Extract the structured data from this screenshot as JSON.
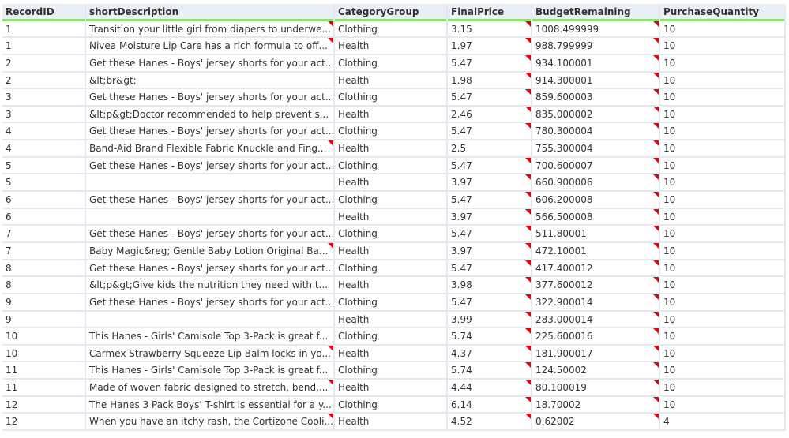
{
  "columns": [
    "RecordID",
    "shortDescription",
    "CategoryGroup",
    "FinalPrice",
    "BudgetRemaining",
    "PurchaseQuantity"
  ],
  "rows": [
    {
      "id": "1",
      "desc": "Transition your little girl from diapers to underwe...",
      "cat": "Clothing",
      "price": "3.15",
      "budget": "1008.499999",
      "qty": "10",
      "df": true,
      "pf": true
    },
    {
      "id": "1",
      "desc": "Nivea Moisture Lip Care has a rich formula to off...",
      "cat": "Health",
      "price": "1.97",
      "budget": "988.799999",
      "qty": "10",
      "df": true,
      "pf": true
    },
    {
      "id": "2",
      "desc": "Get these Hanes - Boys' jersey shorts for your act...",
      "cat": "Clothing",
      "price": "5.47",
      "budget": "934.100001",
      "qty": "10",
      "df": false,
      "pf": true
    },
    {
      "id": "2",
      "desc": "&lt;br&gt;",
      "cat": "Health",
      "price": "1.98",
      "budget": "914.300001",
      "qty": "10",
      "df": false,
      "pf": true
    },
    {
      "id": "3",
      "desc": "Get these Hanes - Boys' jersey shorts for your act...",
      "cat": "Clothing",
      "price": "5.47",
      "budget": "859.600003",
      "qty": "10",
      "df": false,
      "pf": true
    },
    {
      "id": "3",
      "desc": "&lt;p&gt;Doctor recommended to help prevent s...",
      "cat": "Health",
      "price": "2.46",
      "budget": "835.000002",
      "qty": "10",
      "df": false,
      "pf": true
    },
    {
      "id": "4",
      "desc": "Get these Hanes - Boys' jersey shorts for your act...",
      "cat": "Clothing",
      "price": "5.47",
      "budget": "780.300004",
      "qty": "10",
      "df": false,
      "pf": true
    },
    {
      "id": "4",
      "desc": "Band-Aid Brand Flexible Fabric Knuckle and Fing...",
      "cat": "Health",
      "price": "2.5",
      "budget": "755.300004",
      "qty": "10",
      "df": true,
      "pf": false
    },
    {
      "id": "5",
      "desc": "Get these Hanes - Boys' jersey shorts for your act...",
      "cat": "Clothing",
      "price": "5.47",
      "budget": "700.600007",
      "qty": "10",
      "df": false,
      "pf": true
    },
    {
      "id": "5",
      "desc": "",
      "cat": "Health",
      "price": "3.97",
      "budget": "660.900006",
      "qty": "10",
      "df": false,
      "pf": true
    },
    {
      "id": "6",
      "desc": "Get these Hanes - Boys' jersey shorts for your act...",
      "cat": "Clothing",
      "price": "5.47",
      "budget": "606.200008",
      "qty": "10",
      "df": false,
      "pf": true
    },
    {
      "id": "6",
      "desc": "",
      "cat": "Health",
      "price": "3.97",
      "budget": "566.500008",
      "qty": "10",
      "df": false,
      "pf": true
    },
    {
      "id": "7",
      "desc": "Get these Hanes - Boys' jersey shorts for your act...",
      "cat": "Clothing",
      "price": "5.47",
      "budget": "511.80001",
      "qty": "10",
      "df": false,
      "pf": true
    },
    {
      "id": "7",
      "desc": "Baby Magic&reg; Gentle Baby Lotion Original Ba...",
      "cat": "Health",
      "price": "3.97",
      "budget": "472.10001",
      "qty": "10",
      "df": true,
      "pf": true
    },
    {
      "id": "8",
      "desc": "Get these Hanes - Boys' jersey shorts for your act...",
      "cat": "Clothing",
      "price": "5.47",
      "budget": "417.400012",
      "qty": "10",
      "df": false,
      "pf": true
    },
    {
      "id": "8",
      "desc": "&lt;p&gt;Give kids the nutrition they need with t...",
      "cat": "Health",
      "price": "3.98",
      "budget": "377.600012",
      "qty": "10",
      "df": false,
      "pf": true
    },
    {
      "id": "9",
      "desc": "Get these Hanes - Boys' jersey shorts for your act...",
      "cat": "Clothing",
      "price": "5.47",
      "budget": "322.900014",
      "qty": "10",
      "df": false,
      "pf": true
    },
    {
      "id": "9",
      "desc": "",
      "cat": "Health",
      "price": "3.99",
      "budget": "283.000014",
      "qty": "10",
      "df": false,
      "pf": true
    },
    {
      "id": "10",
      "desc": "This Hanes - Girls' Camisole Top 3-Pack is great f...",
      "cat": "Clothing",
      "price": "5.74",
      "budget": "225.600016",
      "qty": "10",
      "df": false,
      "pf": true
    },
    {
      "id": "10",
      "desc": "Carmex Strawberry Squeeze Lip Balm locks in yo...",
      "cat": "Health",
      "price": "4.37",
      "budget": "181.900017",
      "qty": "10",
      "df": true,
      "pf": true
    },
    {
      "id": "11",
      "desc": "This Hanes - Girls' Camisole Top 3-Pack is great f...",
      "cat": "Clothing",
      "price": "5.74",
      "budget": "124.50002",
      "qty": "10",
      "df": false,
      "pf": true
    },
    {
      "id": "11",
      "desc": "Made of woven fabric designed to stretch, bend,...",
      "cat": "Health",
      "price": "4.44",
      "budget": "80.100019",
      "qty": "10",
      "df": true,
      "pf": true
    },
    {
      "id": "12",
      "desc": "The Hanes 3 Pack Boys' T-shirt is essential for a y...",
      "cat": "Clothing",
      "price": "6.14",
      "budget": "18.70002",
      "qty": "10",
      "df": false,
      "pf": true
    },
    {
      "id": "12",
      "desc": "When you have an itchy rash, the Cortizone Cooli...",
      "cat": "Health",
      "price": "4.52",
      "budget": "0.62002",
      "qty": "4",
      "df": true,
      "pf": true
    }
  ]
}
